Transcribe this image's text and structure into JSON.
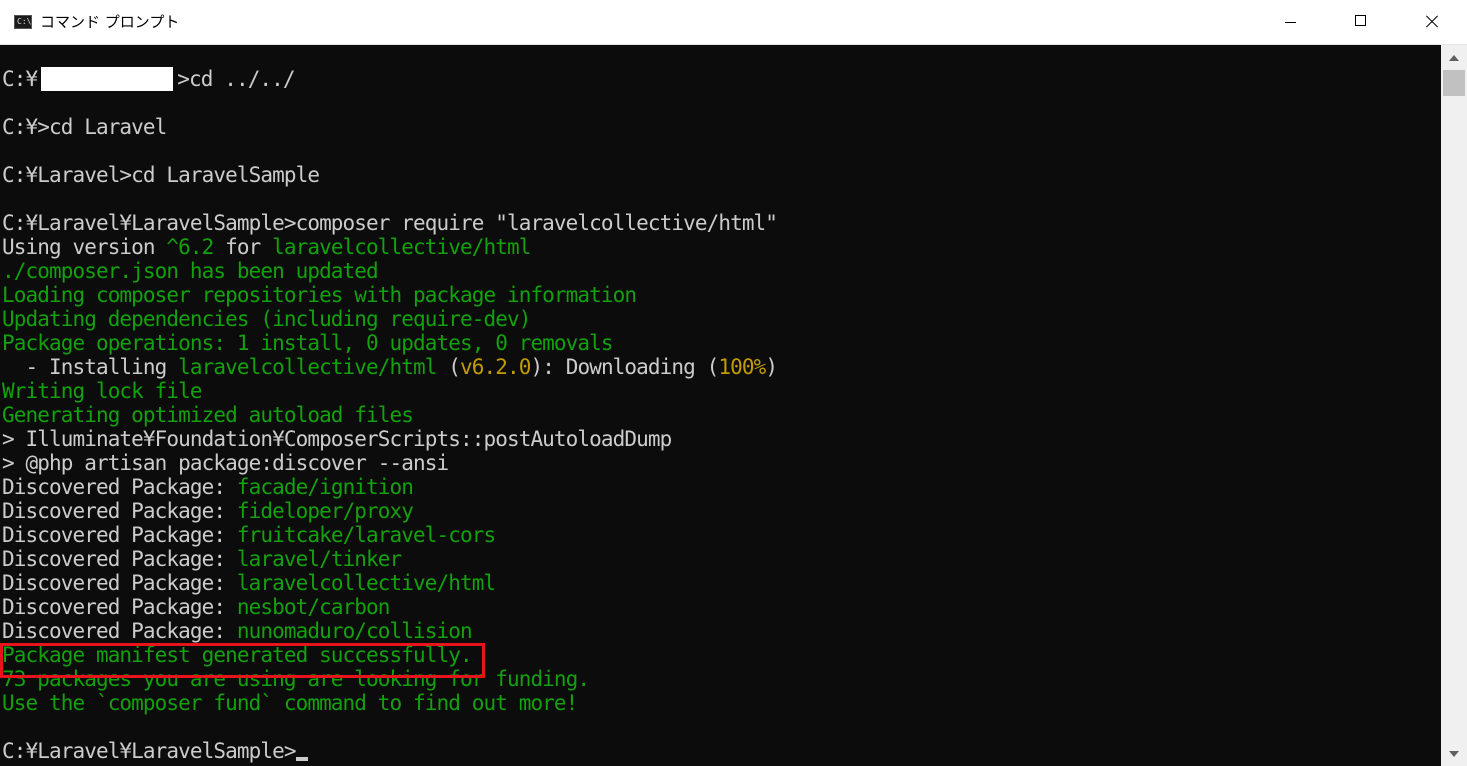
{
  "window": {
    "title": "コマンド プロンプト",
    "icon_label": "C:\\",
    "colors": {
      "background": "#0c0c0c",
      "text": "#cccccc",
      "green": "#13a10e",
      "yellow": "#c19c00",
      "highlight": "#e8141b"
    }
  },
  "console": {
    "lines": [
      [
        {
          "t": "C:¥",
          "c": "w"
        },
        {
          "redact": true
        },
        {
          "t": ">cd ../../",
          "c": "w"
        }
      ],
      [],
      [
        {
          "t": "C:¥>cd Laravel",
          "c": "w"
        }
      ],
      [],
      [
        {
          "t": "C:¥Laravel>cd LaravelSample",
          "c": "w"
        }
      ],
      [],
      [
        {
          "t": "C:¥Laravel¥LaravelSample>composer require \"laravelcollective/html\"",
          "c": "w"
        }
      ],
      [
        {
          "t": "Using version ",
          "c": "w"
        },
        {
          "t": "^6.2",
          "c": "g"
        },
        {
          "t": " for ",
          "c": "w"
        },
        {
          "t": "laravelcollective/html",
          "c": "g"
        }
      ],
      [
        {
          "t": "./composer.json has been updated",
          "c": "g"
        }
      ],
      [
        {
          "t": "Loading composer repositories with package information",
          "c": "g"
        }
      ],
      [
        {
          "t": "Updating dependencies (including require-dev)",
          "c": "g"
        }
      ],
      [
        {
          "t": "Package operations: 1 install, 0 updates, 0 removals",
          "c": "g"
        }
      ],
      [
        {
          "t": "  - Installing ",
          "c": "w"
        },
        {
          "t": "laravelcollective/html",
          "c": "g"
        },
        {
          "t": " (",
          "c": "w"
        },
        {
          "t": "v6.2.0",
          "c": "y"
        },
        {
          "t": "): Downloading (",
          "c": "w"
        },
        {
          "t": "100%",
          "c": "y"
        },
        {
          "t": ")",
          "c": "w"
        }
      ],
      [
        {
          "t": "Writing lock file",
          "c": "g"
        }
      ],
      [
        {
          "t": "Generating optimized autoload files",
          "c": "g"
        }
      ],
      [
        {
          "t": "> Illuminate¥Foundation¥ComposerScripts::postAutoloadDump",
          "c": "w"
        }
      ],
      [
        {
          "t": "> @php artisan package:discover --ansi",
          "c": "w"
        }
      ],
      [
        {
          "t": "Discovered Package: ",
          "c": "w"
        },
        {
          "t": "facade/ignition",
          "c": "g"
        }
      ],
      [
        {
          "t": "Discovered Package: ",
          "c": "w"
        },
        {
          "t": "fideloper/proxy",
          "c": "g"
        }
      ],
      [
        {
          "t": "Discovered Package: ",
          "c": "w"
        },
        {
          "t": "fruitcake/laravel-cors",
          "c": "g"
        }
      ],
      [
        {
          "t": "Discovered Package: ",
          "c": "w"
        },
        {
          "t": "laravel/tinker",
          "c": "g"
        }
      ],
      [
        {
          "t": "Discovered Package: ",
          "c": "w"
        },
        {
          "t": "laravelcollective/html",
          "c": "g"
        }
      ],
      [
        {
          "t": "Discovered Package: ",
          "c": "w"
        },
        {
          "t": "nesbot/carbon",
          "c": "g"
        }
      ],
      [
        {
          "t": "Discovered Package: ",
          "c": "w"
        },
        {
          "t": "nunomaduro/collision",
          "c": "g"
        }
      ],
      [
        {
          "t": "Package manifest generated successfully.",
          "c": "g"
        }
      ],
      [
        {
          "t": "73 packages you are using are looking for funding.",
          "c": "g"
        }
      ],
      [
        {
          "t": "Use the `composer fund` command to find out more!",
          "c": "g"
        }
      ],
      [],
      [
        {
          "t": "C:¥Laravel¥LaravelSample>",
          "c": "w"
        },
        {
          "cursor": true
        }
      ]
    ]
  }
}
